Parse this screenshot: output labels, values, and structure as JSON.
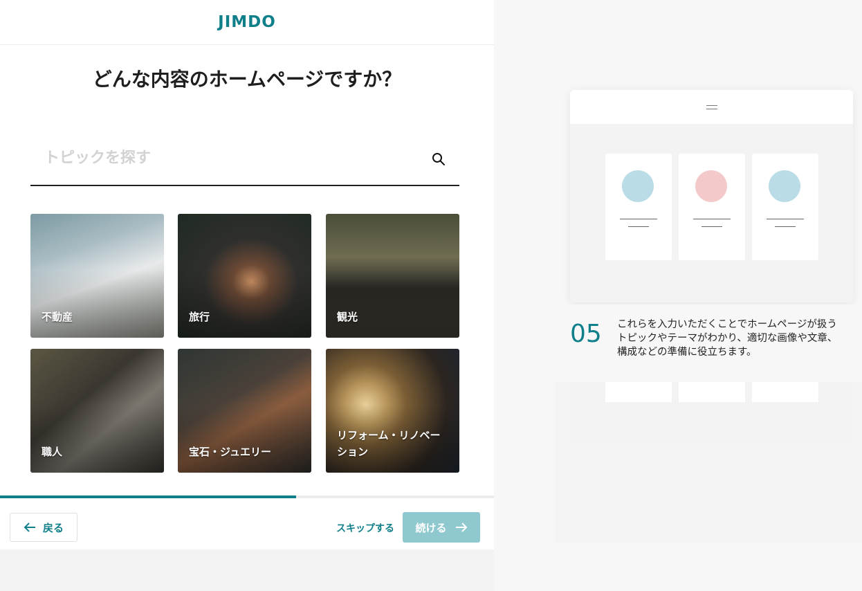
{
  "logo": "JIMDO",
  "title": "どんな内容のホームページですか？",
  "search": {
    "placeholder": "トピックを探す",
    "icon": "search-icon"
  },
  "topics": [
    {
      "label": "不動産"
    },
    {
      "label": "旅行"
    },
    {
      "label": "観光"
    },
    {
      "label": "職人"
    },
    {
      "label": "宝石・ジュエリー"
    },
    {
      "label": "リフォーム・リノベーション"
    }
  ],
  "progress": {
    "fraction": 0.6
  },
  "footer": {
    "back_label": "戻る",
    "skip_label": "スキップする",
    "next_label": "続ける"
  },
  "preview": {
    "step_number": "05",
    "step_text": "これらを入力いただくことでホームページが扱うトピックやテーマがわかり、適切な画像や文章、構成などの準備に役立ちます。",
    "card_circle_colors": [
      "#b9dce6",
      "#f3c9c9",
      "#b9dce6"
    ]
  },
  "colors": {
    "accent": "#0f7f8a",
    "button_disabled": "#8fc8cf"
  }
}
